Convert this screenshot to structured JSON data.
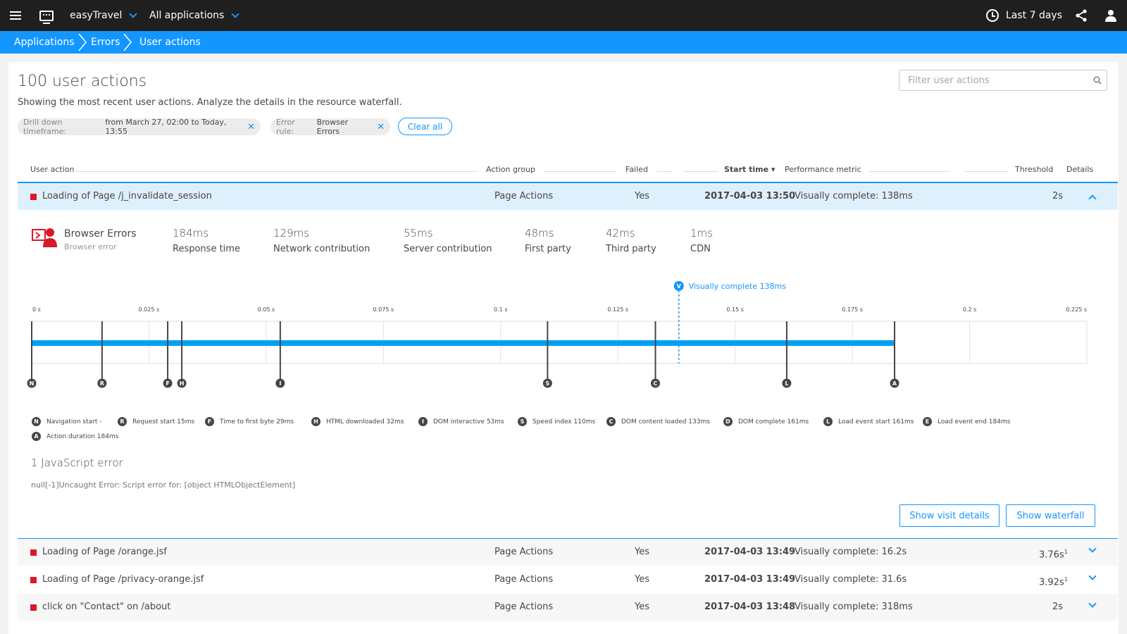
{
  "topbar": {
    "app_name": "easyTravel",
    "app_scope": "All applications",
    "timeframe": "Last 7 days"
  },
  "breadcrumb": [
    "Applications",
    "Errors",
    "User actions"
  ],
  "page": {
    "title": "100 user actions",
    "subtitle": "Showing the most recent user actions. Analyze the details in the resource waterfall.",
    "filter_placeholder": "Filter user actions"
  },
  "chips": [
    {
      "key": "Drill down timeframe:",
      "value": "from March 27, 02:00 to Today, 13:55"
    },
    {
      "key": "Error rule:",
      "value": "Browser Errors"
    }
  ],
  "clear_all": "Clear all",
  "table": {
    "headers": {
      "user_action": "User action",
      "action_group": "Action group",
      "failed": "Failed",
      "start_time": "Start time ▾",
      "perf_metric": "Performance metric",
      "threshold": "Threshold",
      "details": "Details"
    },
    "rows": [
      {
        "name": "Loading of Page /j_invalidate_session",
        "group": "Page Actions",
        "failed": "Yes",
        "start": "2017-04-03 13:50",
        "metric": "Visually complete: 138ms",
        "threshold": "2s",
        "sup": ""
      },
      {
        "name": "Loading of Page /orange.jsf",
        "group": "Page Actions",
        "failed": "Yes",
        "start": "2017-04-03 13:49",
        "metric": "Visually complete: 16.2s",
        "threshold": "3.76s",
        "sup": "1"
      },
      {
        "name": "Loading of Page /privacy-orange.jsf",
        "group": "Page Actions",
        "failed": "Yes",
        "start": "2017-04-03 13:49",
        "metric": "Visually complete: 31.6s",
        "threshold": "3.92s",
        "sup": "1"
      },
      {
        "name": "click on \"Contact\" on /about",
        "group": "Page Actions",
        "failed": "Yes",
        "start": "2017-04-03 13:48",
        "metric": "Visually complete: 318ms",
        "threshold": "2s",
        "sup": ""
      }
    ]
  },
  "detail": {
    "error_title": "Browser Errors",
    "error_sub": "Browser error",
    "metrics": [
      {
        "value": "184ms",
        "label": "Response time"
      },
      {
        "value": "129ms",
        "label": "Network contribution"
      },
      {
        "value": "55ms",
        "label": "Server contribution"
      },
      {
        "value": "48ms",
        "label": "First party"
      },
      {
        "value": "42ms",
        "label": "Third party"
      },
      {
        "value": "1ms",
        "label": "CDN"
      }
    ],
    "timeline": {
      "x_max": 0.225,
      "ticks": [
        {
          "v": 0,
          "label": "0 s"
        },
        {
          "v": 0.025,
          "label": "0.025 s"
        },
        {
          "v": 0.05,
          "label": "0.05 s"
        },
        {
          "v": 0.075,
          "label": "0.075 s"
        },
        {
          "v": 0.1,
          "label": "0.1 s"
        },
        {
          "v": 0.125,
          "label": "0.125 s"
        },
        {
          "v": 0.15,
          "label": "0.15 s"
        },
        {
          "v": 0.175,
          "label": "0.175 s"
        },
        {
          "v": 0.2,
          "label": "0.2 s"
        },
        {
          "v": 0.225,
          "label": "0.225 s"
        }
      ],
      "bar_end": 0.184,
      "visually_complete": {
        "v": 0.138,
        "badge": "V",
        "label": "Visually complete 138ms"
      },
      "markers": [
        {
          "letter": "N",
          "v": 0
        },
        {
          "letter": "R",
          "v": 0.015
        },
        {
          "letter": "F",
          "v": 0.029
        },
        {
          "letter": "H",
          "v": 0.032
        },
        {
          "letter": "I",
          "v": 0.053
        },
        {
          "letter": "S",
          "v": 0.11
        },
        {
          "letter": "C",
          "v": 0.133
        },
        {
          "letter": "L",
          "v": 0.161
        },
        {
          "letter": "A",
          "v": 0.184
        }
      ]
    },
    "legend": [
      {
        "letter": "N",
        "text": "Navigation start -"
      },
      {
        "letter": "R",
        "text": "Request start 15ms"
      },
      {
        "letter": "F",
        "text": "Time to first byte 29ms"
      },
      {
        "letter": "H",
        "text": "HTML downloaded 32ms"
      },
      {
        "letter": "I",
        "text": "DOM interactive 53ms"
      },
      {
        "letter": "S",
        "text": "Speed index 110ms"
      },
      {
        "letter": "C",
        "text": "DOM content loaded 133ms"
      },
      {
        "letter": "D",
        "text": "DOM complete 161ms"
      },
      {
        "letter": "L",
        "text": "Load event start 161ms"
      },
      {
        "letter": "E",
        "text": "Load event end 184ms"
      },
      {
        "letter": "A",
        "text": "Action duration 184ms"
      }
    ],
    "js_error_title": "1 JavaScript error",
    "js_error_text": "null[-1]Uncaught Error: Script error for: [object HTMLObjectElement]",
    "show_visit_details": "Show visit details",
    "show_waterfall": "Show waterfall"
  },
  "colors": {
    "accent": "#1496ff",
    "error": "#dc172a",
    "topbar": "#1f1f1f"
  }
}
